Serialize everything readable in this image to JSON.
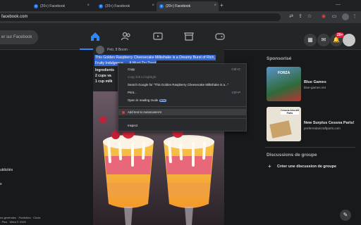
{
  "browser": {
    "tabs": [
      {
        "label": "(20+) Facebook"
      },
      {
        "label": "(20+) Facebook"
      },
      {
        "label": "(20+) Facebook"
      }
    ],
    "new_tab": "+",
    "url": "facebook.com",
    "menu": "⋮"
  },
  "fb": {
    "search_placeholder": "er sur Facebook",
    "notif_badge": "20+"
  },
  "post": {
    "author_meta": "Petr, 8 Boom ·",
    "title_line1": "This Golden Raspberry Cheesecake Milkshake is a Dreamy Burst of Rich,",
    "title_line2": "Fruity Indulgence. ... A Must-Try Treat",
    "ingredients": "Ingredients",
    "ing1": "2 cups va",
    "ing2": "1 cup milk"
  },
  "context_menu": [
    {
      "label": "Copy",
      "shortcut": "Ctrl+C",
      "disabled": false
    },
    {
      "label": "Copy link to highlight",
      "shortcut": "",
      "disabled": true
    },
    {
      "label": "Search Google for \"This Golden Raspberry Cheesecake Milkshake is a...\"",
      "shortcut": "",
      "disabled": false
    },
    {
      "label": "Print...",
      "shortcut": "Ctrl+P",
      "disabled": false
    },
    {
      "label": "Open in reading mode",
      "shortcut": "",
      "badge": "NEW",
      "disabled": false
    },
    {
      "label": "Add text to AutoscanerAI",
      "shortcut": "",
      "disabled": false
    },
    {
      "label": "Inspect",
      "shortcut": "",
      "disabled": false
    }
  ],
  "right": {
    "sponsored": "Sponsorisé",
    "ad1_title": "Blue Games",
    "ad1_sub": "blue-games.net",
    "ad1_img": "FORZA",
    "ad2_title": "New Surplus Cessna Parts!",
    "ad2_sub": "preferredaircraftparts.com",
    "ad2_img": "Cessna Aircraft Parts",
    "groups_title": "Discussions de groupe",
    "create_group": "Créer une discussion de groupe"
  },
  "left": {
    "frag1": "ublicités",
    "frag2": "s",
    "footer1": "ns générales · Publicités · Choix",
    "footer2": "· Plus · Meta © 2025"
  },
  "colors": {
    "fb_blue": "#1877f2",
    "bg": "#18191a",
    "card": "#242526",
    "highlight": "#3367d6"
  }
}
